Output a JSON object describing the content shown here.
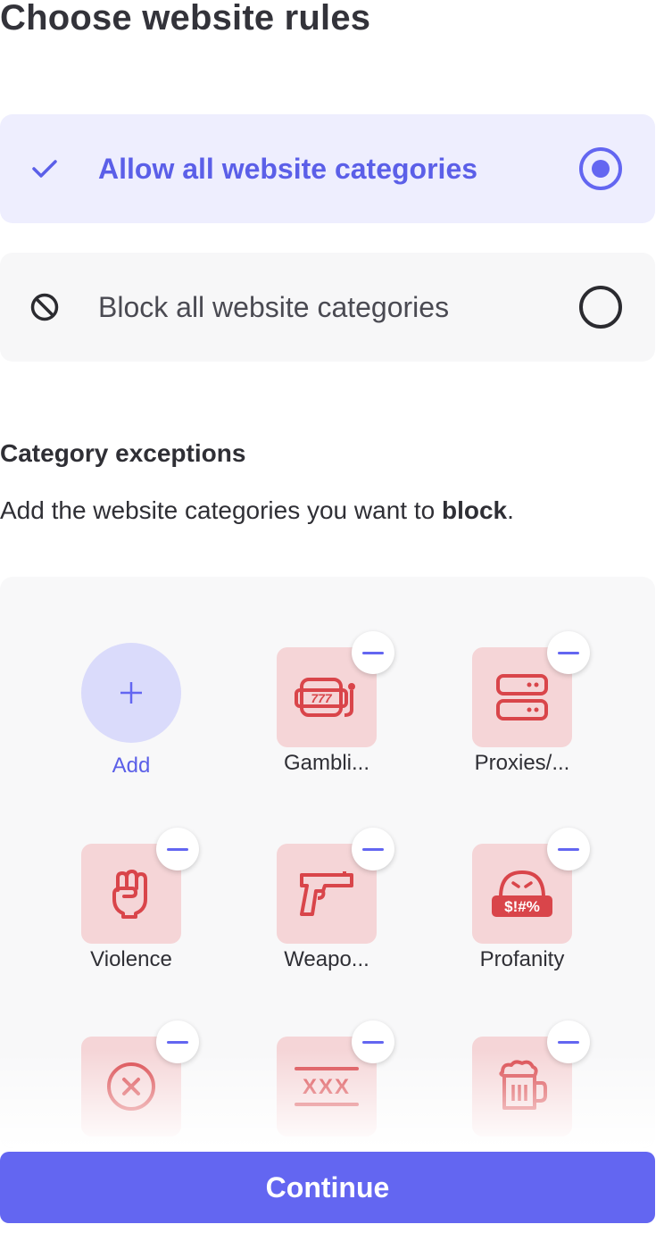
{
  "page": {
    "title": "Choose website rules"
  },
  "options": {
    "allow": {
      "label": "Allow all website categories",
      "selected": true,
      "icon": "check-icon"
    },
    "block": {
      "label": "Block all website categories",
      "selected": false,
      "icon": "block-icon"
    }
  },
  "exceptions": {
    "title": "Category exceptions",
    "description_prefix": "Add the website categories you want to ",
    "description_bold": "block",
    "description_suffix": ".",
    "add_label": "Add",
    "categories": [
      {
        "label": "Gambli...",
        "icon": "slot-machine-icon"
      },
      {
        "label": "Proxies/...",
        "icon": "server-icon"
      },
      {
        "label": "Violence",
        "icon": "fist-icon"
      },
      {
        "label": "Weapo...",
        "icon": "gun-icon"
      },
      {
        "label": "Profanity",
        "icon": "angry-face-icon"
      },
      {
        "label": "",
        "icon": "x-circle-icon"
      },
      {
        "label": "",
        "icon": "xxx-icon"
      },
      {
        "label": "",
        "icon": "beer-mug-icon"
      }
    ]
  },
  "footer": {
    "continue_label": "Continue"
  },
  "colors": {
    "accent": "#6366f1",
    "tile_bg": "#f5d5d7",
    "tile_icon": "#d9454a",
    "selected_bg": "#eeeefe"
  }
}
